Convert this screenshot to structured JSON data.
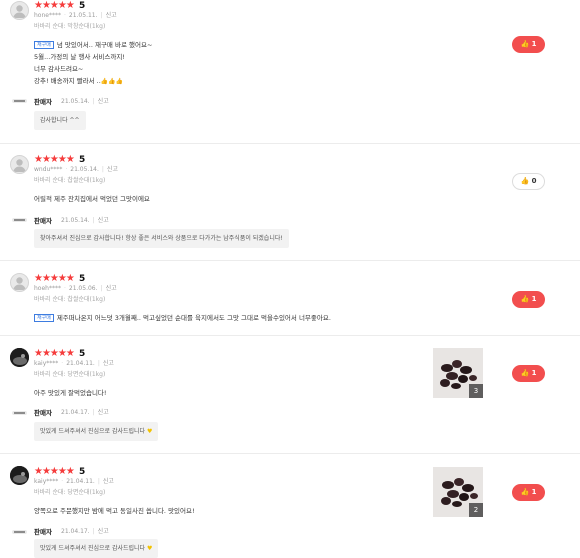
{
  "reviews": [
    {
      "stars": "★★★★★",
      "score": "5",
      "author": "hone****",
      "date": "21.05.11.",
      "report": "신고",
      "option": "바바리 순대: 막창순대(1kg)",
      "tag": "재구매",
      "lines": [
        "넘 맛있어서.. 재구매 바로 했어요~",
        "5월...가정의 날 행사 서비스까지!",
        "너무 감사드려요~",
        "강추! 배송까지 빨라서 .."
      ],
      "emoji": "👍👍👍",
      "likes": "1",
      "liked": true,
      "seller": {
        "name": "판매자",
        "date": "21.05.14.",
        "report": "신고",
        "reply": "감사합니다 ^^"
      }
    },
    {
      "stars": "★★★★★",
      "score": "5",
      "author": "wndu****",
      "date": "21.05.14.",
      "report": "신고",
      "option": "바바리 순대: 찹쌀순대(1kg)",
      "lines": [
        "어릴적 제주 잔치집에서 먹었던 그맛이에요"
      ],
      "likes": "0",
      "liked": false,
      "seller": {
        "name": "판매자",
        "date": "21.05.14.",
        "report": "신고",
        "reply": "찾아주셔서 진심으로 감사합니다! 항상 좋은 서비스와 상품으로 다가가는 남주식품이 되겠습니다!"
      }
    },
    {
      "stars": "★★★★★",
      "score": "5",
      "author": "hoeh****",
      "date": "21.05.06.",
      "report": "신고",
      "option": "바바리 순대: 찹쌀순대(1kg)",
      "tag": "재구매",
      "lines": [
        "제주떠나온지 어느덧 3개월째.. 먹고싶었던 순대를 육지에서도 그맛 그대로 먹을수있어서 너무좋아요."
      ],
      "likes": "1",
      "liked": true
    },
    {
      "stars": "★★★★★",
      "score": "5",
      "author": "kaiy****",
      "date": "21.04.11.",
      "report": "신고",
      "option": "바바리 순대: 당면순대(1kg)",
      "lines": [
        "아주 맛있게 잘먹었습니다!"
      ],
      "photo_count": "3",
      "likes": "1",
      "liked": true,
      "seller": {
        "name": "판매자",
        "date": "21.04.17.",
        "report": "신고",
        "reply": "맛있게 드셔주셔서 진심으로 감사드립니다"
      }
    },
    {
      "stars": "★★★★★",
      "score": "5",
      "author": "kaiy****",
      "date": "21.04.11.",
      "report": "신고",
      "option": "바바리 순대: 당면순대(1kg)",
      "lines": [
        "양쪽으로 주문했지만 밤에 먹고 동일사진 씁니다. 맛있어요!"
      ],
      "photo_count": "2",
      "likes": "1",
      "liked": true,
      "seller": {
        "name": "판매자",
        "date": "21.04.17.",
        "report": "신고",
        "reply": "맛있게 드셔주셔서 진심으로 감사드립니다"
      }
    }
  ],
  "colors": {
    "star": "#f53c3c",
    "like_active": "#f24e4e",
    "tag": "#3d7ce0"
  },
  "icons": {
    "like": "thumbs-up-icon",
    "avatar_default": "user-silhouette-icon",
    "reply_heart": "yellow-heart-icon",
    "seller_logo": "seller-logo-icon"
  }
}
